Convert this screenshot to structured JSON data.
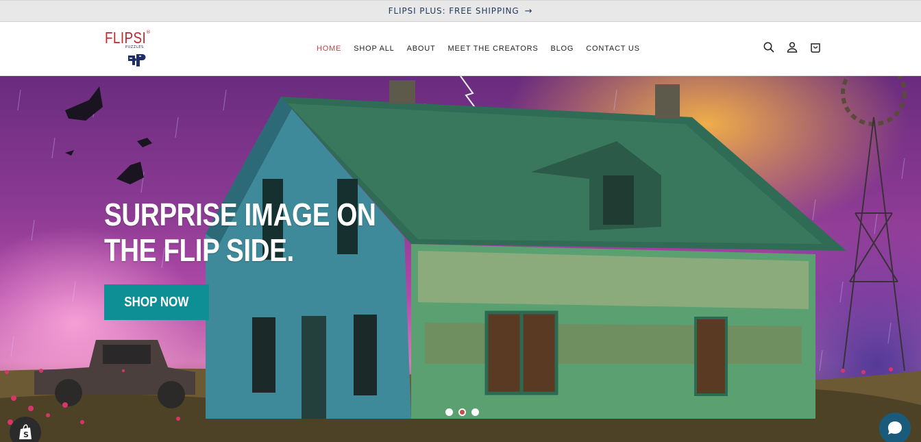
{
  "announcement": {
    "text": "FLIPSI PLUS: FREE SHIPPING",
    "arrow_icon": "arrow-right-icon"
  },
  "header": {
    "logo": {
      "word": "FLIPSI",
      "reg": "®",
      "sub": "PUZZLES",
      "mark_icon": "fp-puzzle-logo-icon"
    },
    "nav": [
      {
        "label": "HOME",
        "active": true
      },
      {
        "label": "SHOP ALL"
      },
      {
        "label": "ABOUT"
      },
      {
        "label": "MEET THE CREATORS"
      },
      {
        "label": "BLOG"
      },
      {
        "label": "CONTACT US"
      }
    ],
    "icons": [
      "search-icon",
      "account-icon",
      "cart-icon"
    ]
  },
  "hero": {
    "title": "SURPRISE IMAGE ON THE FLIP SIDE.",
    "button": "SHOP NOW",
    "slides": 3,
    "active_slide": 2
  },
  "colors": {
    "accent": "#0e8f96",
    "brand_red": "#c0262e",
    "nav_active": "#c84040",
    "announce_text": "#1f3a5a"
  }
}
